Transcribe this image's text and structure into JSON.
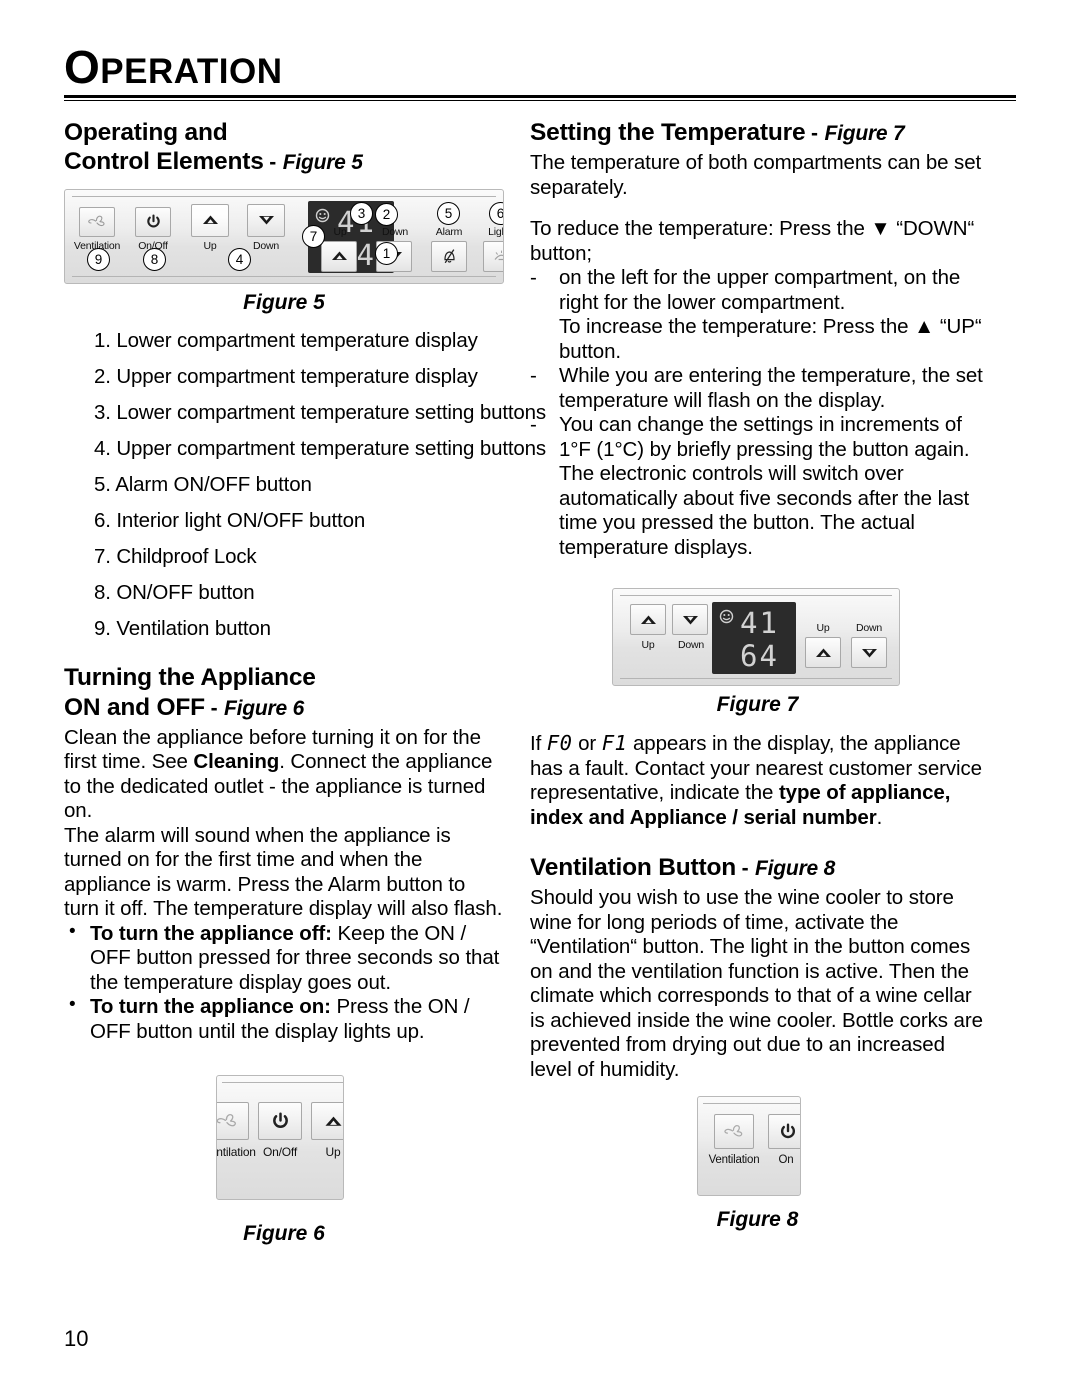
{
  "chapter": {
    "title": "OPERATION",
    "title_first": "O",
    "title_rest": "PERATION"
  },
  "page": {
    "number": "10"
  },
  "left_column": {
    "section1": {
      "heading_line1": "Operating and",
      "heading_line2": "Control Elements",
      "heading_dash": "-",
      "heading_figref": "Figure 5",
      "figure_caption": "Figure 5",
      "items": [
        "1. Lower compartment temperature display",
        "2. Upper compartment temperature display",
        "3. Lower compartment temperature setting buttons",
        "4. Upper compartment temperature setting buttons",
        "5. Alarm ON/OFF button",
        "6. Interior light ON/OFF button",
        "7. Childproof Lock",
        "8. ON/OFF button",
        "9. Ventilation button"
      ]
    },
    "section2": {
      "heading_line1": "Turning the Appliance",
      "heading_line2": "ON and OFF",
      "heading_dash": "-",
      "heading_figref": "Figure 6",
      "para1_a": "Clean the appliance before turning it on for the first time. See ",
      "para1_bold": "Cleaning",
      "para1_b": ". Connect the appliance to the dedicated outlet - the appliance is turned on.",
      "para2": "The alarm will sound when the appliance is turned on for the first time and when the appliance is warm. Press the Alarm button to turn it off. The temperature display will also flash.",
      "bullet1_bold": "To turn the appliance off:",
      "bullet1_rest": " Keep the  ON / OFF button pressed for three seconds so that the temperature display goes out.",
      "bullet2_bold": "To turn the appliance on:",
      "bullet2_rest": " Press the ON / OFF button until the display lights up.",
      "figure_caption": "Figure 6"
    }
  },
  "right_column": {
    "section1": {
      "heading": "Setting the Temperature",
      "heading_dash": "-",
      "heading_figref": "Figure 7",
      "para1": "The temperature of both compartments can be set separately.",
      "para2": "To reduce the temperature: Press the ▼ “DOWN“ button;",
      "dash_items": [
        {
          "marker": "-",
          "text": "on the left for the upper compartment, on the right for the lower compartment."
        },
        {
          "marker": "",
          "text": "To increase the temperature: Press the ▲ “UP“ button."
        },
        {
          "marker": "-",
          "text": "While you are entering the temperature, the set temperature will flash on the display."
        },
        {
          "marker": "-",
          "text": "You can change the settings in increments of 1°F (1°C) by briefly pressing the button again. The electronic controls will switch over automatically about five seconds after the last time you pressed the button. The actual temperature displays."
        }
      ],
      "figure_caption": "Figure 7",
      "fault_a": "If ",
      "fault_code1": "F0",
      "fault_b": " or ",
      "fault_code2": "F1",
      "fault_c": " appears in the display, the appliance has a fault. Contact your nearest customer service representative, indicate the ",
      "fault_bold": "type of appliance, index and Appliance / serial number",
      "fault_d": "."
    },
    "section2": {
      "heading": "Ventilation Button",
      "heading_dash": "-",
      "heading_figref": "Figure 8",
      "para1": "Should you wish to use the wine cooler to store wine for long periods of time, activate the “Ventilation“ button. The light in the button comes on and the ventilation function is active. Then the climate which corresponds to that of a wine cellar is achieved inside the wine cooler. Bottle corks are prevented from drying out due to an increased level of humidity.",
      "figure_caption": "Figure 8"
    }
  },
  "figure5": {
    "buttons": [
      {
        "label": "Ventilation",
        "icon": "fan-icon",
        "callout": "9"
      },
      {
        "label": "On/Off",
        "icon": "power-icon",
        "callout": "8"
      },
      {
        "label": "Up",
        "icon": "triangle-up-icon",
        "callout": ""
      },
      {
        "label": "Down",
        "icon": "triangle-down-icon",
        "callout": "4"
      }
    ],
    "display": {
      "upper": "41",
      "lower": "64",
      "icon": "smiley-childproof-icon"
    },
    "display_callouts": {
      "upper": "2",
      "lower": "1",
      "lock": "7"
    },
    "right_buttons": [
      {
        "label": "Up",
        "icon": "triangle-up-icon",
        "callout": "3"
      },
      {
        "label": "Down",
        "icon": "triangle-down-icon",
        "callout": ""
      },
      {
        "label": "Alarm",
        "icon": "bell-crossed-icon",
        "callout": "5"
      },
      {
        "label": "Light",
        "icon": "lamp-icon",
        "callout": "6"
      }
    ]
  },
  "figure6": {
    "buttons": [
      {
        "label": "ntilation",
        "icon": "fan-icon"
      },
      {
        "label": "On/Off",
        "icon": "power-icon"
      },
      {
        "label": "Up",
        "icon": "triangle-up-icon"
      }
    ]
  },
  "figure7": {
    "left_buttons": [
      {
        "label": "Up",
        "icon": "triangle-up-icon"
      },
      {
        "label": "Down",
        "icon": "triangle-down-icon"
      }
    ],
    "display": {
      "upper": "41",
      "lower": "64",
      "icon": "smiley-childproof-icon"
    },
    "right_buttons": [
      {
        "label": "Up",
        "icon": "triangle-up-icon"
      },
      {
        "label": "Down",
        "icon": "triangle-down-icon"
      }
    ]
  },
  "figure8": {
    "buttons": [
      {
        "label": "Ventilation",
        "icon": "fan-icon"
      },
      {
        "label": "On",
        "icon": "power-icon"
      }
    ]
  }
}
